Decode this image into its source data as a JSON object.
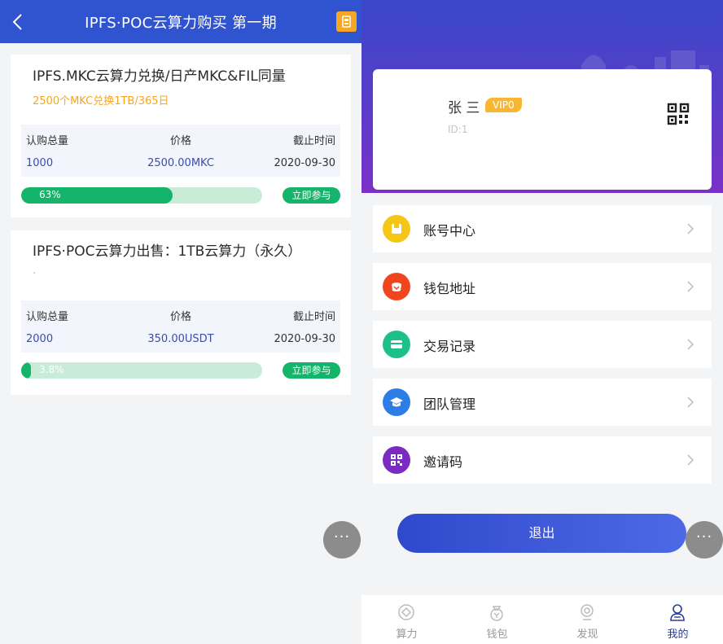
{
  "left": {
    "header_title": "IPFS·POC云算力购买 第一期",
    "cards": [
      {
        "title": "IPFS.MKC云算力兑换/日产MKC&FIL同量",
        "subtitle": "2500个MKC兑换1TB/365日",
        "headers": [
          "认购总量",
          "价格",
          "截止时间"
        ],
        "values": [
          "1000",
          "2500.00MKC",
          "2020-09-30"
        ],
        "progress_label": "63%",
        "progress": 0.63,
        "join_label": "立即参与"
      },
      {
        "title": "IPFS·POC云算力出售：1TB云算力（永久）",
        "subtitle": ".",
        "headers": [
          "认购总量",
          "价格",
          "截止时间"
        ],
        "values": [
          "2000",
          "350.00USDT",
          "2020-09-30"
        ],
        "progress_label": "3.8%",
        "progress": 0.038,
        "join_label": "立即参与"
      }
    ],
    "more_label": "···"
  },
  "right": {
    "profile": {
      "name": "张 三",
      "vip": "VIP0",
      "id": "ID:1"
    },
    "menu": [
      {
        "label": "账号中心",
        "icon": "account-icon",
        "color": "#f5c518"
      },
      {
        "label": "钱包地址",
        "icon": "wallet-icon",
        "color": "#f0451f"
      },
      {
        "label": "交易记录",
        "icon": "card-icon",
        "color": "#1dbf8a"
      },
      {
        "label": "团队管理",
        "icon": "graduation-cap-icon",
        "color": "#2e7de6"
      },
      {
        "label": "邀请码",
        "icon": "qr-icon",
        "color": "#7a2bc2"
      }
    ],
    "logout_label": "退出",
    "more_label": "···",
    "tabs": [
      {
        "label": "算力",
        "icon": "power-icon"
      },
      {
        "label": "钱包",
        "icon": "wallet-bag-icon"
      },
      {
        "label": "发现",
        "icon": "discover-icon"
      },
      {
        "label": "我的",
        "icon": "profile-icon"
      }
    ]
  },
  "colors": {
    "primary_blue": "#3053cf",
    "green": "#14b56a",
    "orange": "#f5a623",
    "hero_purple": "#7a31c8"
  }
}
